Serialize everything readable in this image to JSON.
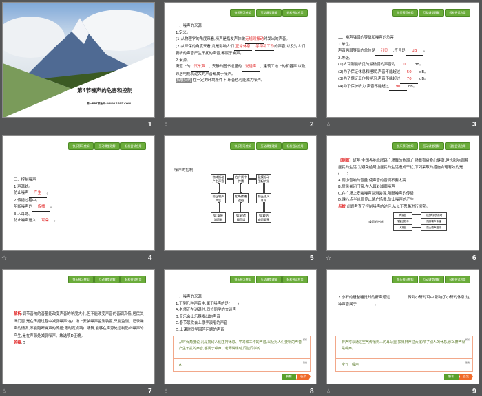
{
  "nav_buttons": [
    "快乐预习感知",
    "互动课堂理解",
    "轻松尝试应用"
  ],
  "slides": [
    {
      "number": "1",
      "title": "第4节噪声的危害和控制",
      "subtitle": "第一PPT模板网-WWW.1PPT.COM"
    },
    {
      "number": "2",
      "lines": [
        [
          {
            "t": "一、噪声的来源"
          }
        ],
        [
          {
            "t": "1.定义。"
          }
        ],
        [
          {
            "t": "(1)从物理学的角度来看,噪声是指发声体做"
          },
          {
            "a": "无规则振动"
          },
          {
            "t": "时发出的声音。"
          }
        ],
        [
          {
            "t": "(2)从环保的角度来看,凡是影响人们"
          },
          {
            "a": "正常休息"
          },
          {
            "t": "、"
          },
          {
            "a": "学习和工作"
          },
          {
            "t": "的声音,以及对人们要听的声音产生干扰的声音,都属于噪声。"
          }
        ],
        [
          {
            "t": "2.来源。"
          }
        ],
        [
          {
            "t": "街道上的"
          },
          {
            "a": "汽车声"
          },
          {
            "t": "、安静的图书馆里的"
          },
          {
            "a": "说话声"
          },
          {
            "t": "、建筑工地上的机器声,以及邻居电视机过大的声音都属于噪声。"
          }
        ],
        [
          {
            "g": "拓展归纳"
          },
          {
            "t": " 在一定的环境条件下,乐音也可能成为噪声。"
          }
        ]
      ]
    },
    {
      "number": "3",
      "lines": [
        [
          {
            "t": "二、噪声强弱的等级和噪声的危害"
          }
        ],
        [
          {
            "t": "1.单位。"
          }
        ],
        [
          {
            "t": "声音强弱等级的单位是"
          },
          {
            "a": "分贝"
          },
          {
            "t": ",符号是"
          },
          {
            "a": "dB"
          },
          {
            "t": "。"
          }
        ],
        [
          {
            "t": "2.等级。"
          }
        ],
        [
          {
            "t": "(1)人耳刚能听见的最微弱的声音为"
          },
          {
            "a": "0"
          },
          {
            "t": " dB。"
          }
        ],
        [
          {
            "t": "(2)为了保证休息和睡眠,声音不能超过"
          },
          {
            "a": "50"
          },
          {
            "t": " dB。"
          }
        ],
        [
          {
            "t": "(3)为了保证工作和学习,声音不能超过"
          },
          {
            "a": "70"
          },
          {
            "t": " dB。"
          }
        ],
        [
          {
            "t": "(4)为了保护听力,声音不能超过"
          },
          {
            "a": "90"
          },
          {
            "t": " dB。"
          }
        ]
      ]
    },
    {
      "number": "4",
      "lines": [
        [
          {
            "t": "三、控制噪声"
          }
        ],
        [
          {
            "t": "1.声源处。"
          }
        ],
        [
          {
            "t": "防止噪声"
          },
          {
            "a": "产生"
          },
          {
            "t": "。"
          }
        ],
        [
          {
            "t": "2.传播过程中。"
          }
        ],
        [
          {
            "t": "阻断噪声的"
          },
          {
            "a": "传播"
          },
          {
            "t": "。"
          }
        ],
        [
          {
            "t": "3.人耳处。"
          }
        ],
        [
          {
            "t": "防止噪声进入"
          },
          {
            "a": "耳朵"
          },
          {
            "t": "。"
          }
        ]
      ]
    },
    {
      "number": "5",
      "heading": "噪声的控制",
      "diagram": {
        "top": [
          "物体振动产生声音",
          "在介质中传播",
          "鼓膜振动引起听觉"
        ],
        "middle": [
          "防止噪声产生",
          "阻断传播途径",
          "防止进入耳朵"
        ],
        "bottom": [
          "如:安装消声器",
          "如:建造隔音墙",
          "如:戴防噪声耳罩"
        ]
      }
    },
    {
      "number": "6",
      "lines": [
        [
          {
            "r": "【例题】"
          },
          {
            "t": "近年,全国各地掀起跳广场舞的热潮,广场舞有益身心健康,但也影响周围居民的生活,为避免给周边居民的生活造成干扰,下列采取的措施合理有效的是(　　)"
          }
        ],
        [
          {
            "t": "A.调小音响的音量,使声音的音调不要太高"
          }
        ],
        [
          {
            "t": "B.居民关闭门窗,在人耳处减弱噪声"
          }
        ],
        [
          {
            "t": "C.在广场上安装噪声监测装置,阻断噪声的传播"
          }
        ],
        [
          {
            "t": "D.晚八点半以后停止跳广场舞,防止噪声的产生"
          }
        ],
        [
          {
            "r": "点拨"
          },
          {
            "t": ":此题考查了控制噪声的途径,从以下思路进行探究。"
          }
        ]
      ],
      "diagram": {
        "root": "噪声的控制",
        "branches": [
          "声源处",
          "传播过程中",
          "人耳处"
        ],
        "results": [
          "防止声源的振动",
          "阻断噪声传播",
          "防止噪声进耳"
        ]
      }
    },
    {
      "number": "7",
      "lines": [
        [
          {
            "r": "解析"
          },
          {
            "t": ":调节音响的音量能改变声音的响度大小,但不能改变声音的音调高低;居民关闭门窗,是在传播过程中减弱噪声;在广场上安装噪声监测装置,只能监测、记录噪声的情况,不能阻断噪声的传播;限时定点跳广场舞,能够在声源处控制防止噪声的产生,是在声源处减弱噪声。故选项D正确。"
          }
        ],
        [
          {
            "r": "答案"
          },
          {
            "t": ":D"
          }
        ]
      ]
    },
    {
      "number": "8",
      "lines": [
        [
          {
            "t": "一、噪声的来源"
          }
        ],
        [
          {
            "t": "1.下列几种声音中,属于噪声的是(　　)"
          }
        ],
        [
          {
            "t": "A.老师正在讲课时,同位同学的交谈声"
          }
        ],
        [
          {
            "t": "B.音乐会上乐器发出的声音"
          }
        ],
        [
          {
            "t": "C.春节联欢会上歌手演唱的声音"
          }
        ],
        [
          {
            "t": "D.上课时同学回答问题的声音"
          }
        ]
      ],
      "analysis": "从环保角度说,凡是妨碍人们正常休息、学习和工作的声音,以及对人们要听的声音产生干扰的声音,都属于噪声。老师讲课时,同位同学的",
      "answer": "A",
      "analysis_label": "解析",
      "answer_label": "答案"
    },
    {
      "number": "9",
      "lines": [
        [
          {
            "t": "2.小轩的爸爸睡觉时的鼾声通过"
          },
          {
            "a": " "
          },
          {
            "t": "传到小轩的耳中,影响了小轩的休息,这种声音属于"
          },
          {
            "a": " "
          },
          {
            "t": "。"
          }
        ]
      ],
      "analysis": "鼾声可以通过空气传播到人的耳朵里,如果鼾声过大,影响了别人的休息,那么鼾声就是噪声。",
      "answer": "空气　噪声",
      "analysis_label": "解析",
      "answer_label": "答案"
    }
  ],
  "colors": {
    "nav_green": "#6aac3a",
    "answer_red": "#e02020",
    "background": "#555657"
  }
}
